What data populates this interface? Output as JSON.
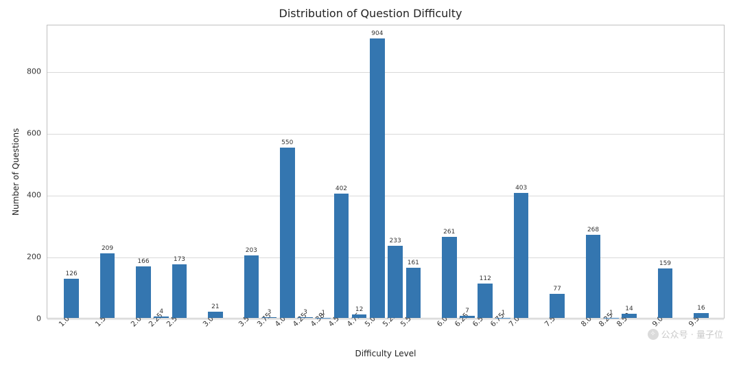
{
  "chart_data": {
    "type": "bar",
    "title": "Distribution of Question Difficulty",
    "xlabel": "Difficulty Level",
    "ylabel": "Number of Questions",
    "ylim": [
      0,
      950
    ],
    "y_ticks": [
      0,
      200,
      400,
      600,
      800
    ],
    "categories": [
      "1.00",
      "1.50",
      "2.00",
      "2.25",
      "2.50",
      "3.00",
      "3.50",
      "3.75",
      "4.00",
      "4.25",
      "4.38",
      "4.50",
      "4.75",
      "5.00",
      "5.25",
      "5.50",
      "6.00",
      "6.25",
      "6.50",
      "6.75",
      "7.00",
      "7.50",
      "8.00",
      "8.25",
      "8.50",
      "9.00",
      "9.50"
    ],
    "values": [
      126,
      209,
      166,
      4,
      173,
      21,
      203,
      3,
      550,
      3,
      1,
      402,
      12,
      904,
      233,
      161,
      261,
      7,
      112,
      1,
      403,
      77,
      268,
      1,
      14,
      159,
      16
    ],
    "color": "#3476b0"
  },
  "watermark": {
    "text": "公众号 · 量子位"
  }
}
